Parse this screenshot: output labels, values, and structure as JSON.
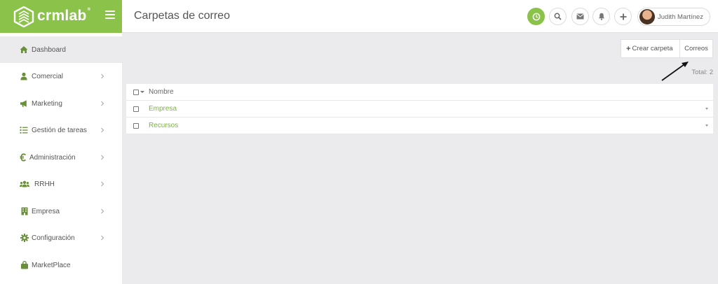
{
  "app": {
    "logo_text": "crmlab",
    "logo_registered": "®",
    "brand_color": "#8bc34a"
  },
  "header": {
    "title": "Carpetas de correo",
    "buttons": [
      {
        "name": "clock-icon",
        "active": true
      },
      {
        "name": "search-icon",
        "active": false
      },
      {
        "name": "mail-icon",
        "active": false
      },
      {
        "name": "bell-icon",
        "active": false
      },
      {
        "name": "plus-icon",
        "active": false
      }
    ],
    "user_name": "Judith Martínez"
  },
  "sidebar": {
    "items": [
      {
        "label": "Dashboard",
        "icon": "home-icon",
        "chevron": false,
        "active": true
      },
      {
        "label": "Comercial",
        "icon": "user-icon",
        "chevron": true,
        "active": false
      },
      {
        "label": "Marketing",
        "icon": "megaphone-icon",
        "chevron": true,
        "active": false
      },
      {
        "label": "Gestión de tareas",
        "icon": "tasks-icon",
        "chevron": true,
        "active": false
      },
      {
        "label": "Administración",
        "icon": "euro-icon",
        "chevron": true,
        "active": false
      },
      {
        "label": "RRHH",
        "icon": "users-icon",
        "chevron": true,
        "active": false
      },
      {
        "label": "Empresa",
        "icon": "building-icon",
        "chevron": true,
        "active": false
      },
      {
        "label": "Configuración",
        "icon": "gear-icon",
        "chevron": true,
        "active": false
      },
      {
        "label": "MarketPlace",
        "icon": "shopping-bag-icon",
        "chevron": false,
        "active": false
      }
    ]
  },
  "toolbar": {
    "create_plus": "+",
    "create_label": "Crear carpeta",
    "mail_label": "Correos"
  },
  "list": {
    "total_label": "Total: 2",
    "column_header": "Nombre",
    "rows": [
      {
        "name": "Empresa"
      },
      {
        "name": "Recursos"
      }
    ]
  }
}
